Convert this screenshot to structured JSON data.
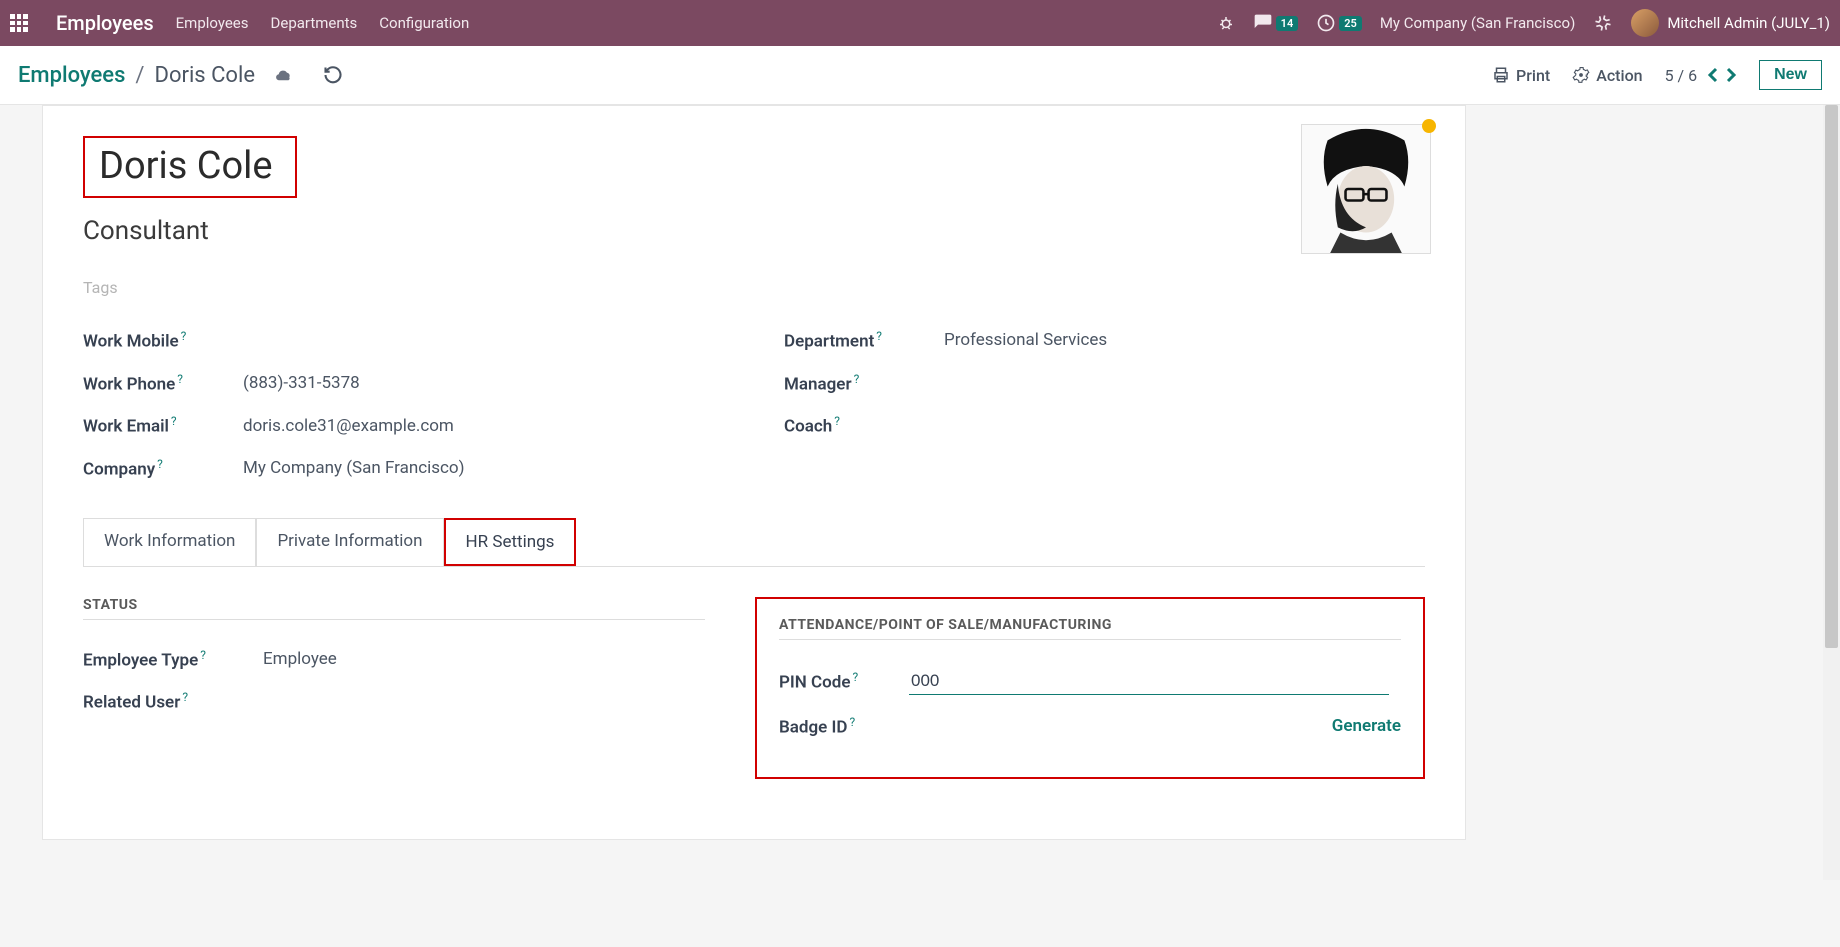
{
  "navbar": {
    "app_title": "Employees",
    "menu": [
      "Employees",
      "Departments",
      "Configuration"
    ],
    "messages_badge": "14",
    "activities_badge": "25",
    "company": "My Company (San Francisco)",
    "user": "Mitchell Admin (JULY_1)"
  },
  "controlbar": {
    "breadcrumb_root": "Employees",
    "breadcrumb_current": "Doris Cole",
    "print_label": "Print",
    "action_label": "Action",
    "pager": "5 / 6",
    "new_label": "New"
  },
  "employee": {
    "name": "Doris Cole",
    "job_title": "Consultant",
    "tags_placeholder": "Tags",
    "fields_left": {
      "work_mobile_label": "Work Mobile",
      "work_mobile_value": "",
      "work_phone_label": "Work Phone",
      "work_phone_value": "(883)-331-5378",
      "work_email_label": "Work Email",
      "work_email_value": "doris.cole31@example.com",
      "company_label": "Company",
      "company_value": "My Company (San Francisco)"
    },
    "fields_right": {
      "department_label": "Department",
      "department_value": "Professional Services",
      "manager_label": "Manager",
      "manager_value": "",
      "coach_label": "Coach",
      "coach_value": ""
    }
  },
  "tabs": {
    "tab1": "Work Information",
    "tab2": "Private Information",
    "tab3": "HR Settings"
  },
  "hr": {
    "status_title": "STATUS",
    "employee_type_label": "Employee Type",
    "employee_type_value": "Employee",
    "related_user_label": "Related User",
    "attendance_title": "ATTENDANCE/POINT OF SALE/MANUFACTURING",
    "pin_label": "PIN Code",
    "pin_value": "000",
    "badge_label": "Badge ID",
    "generate_label": "Generate"
  }
}
